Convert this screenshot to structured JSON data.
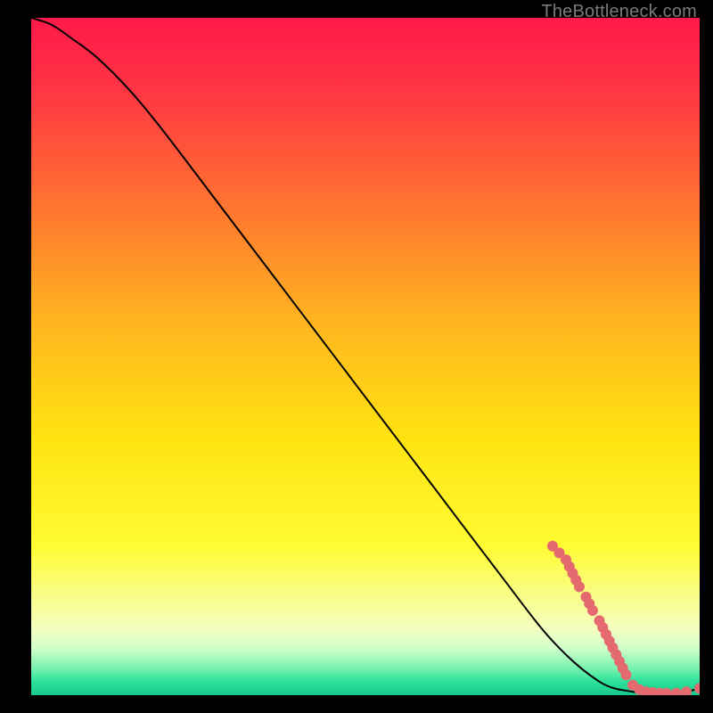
{
  "attribution": "TheBottleneck.com",
  "chart_data": {
    "type": "line",
    "title": "",
    "xlabel": "",
    "ylabel": "",
    "xlim": [
      0,
      100
    ],
    "ylim": [
      0,
      100
    ],
    "grid": false,
    "legend": false,
    "background_gradient": {
      "stops": [
        {
          "pct": 0,
          "color": "#ff1a4a"
        },
        {
          "pct": 10,
          "color": "#ff3344"
        },
        {
          "pct": 25,
          "color": "#ff6a33"
        },
        {
          "pct": 45,
          "color": "#ffb51f"
        },
        {
          "pct": 62,
          "color": "#ffe311"
        },
        {
          "pct": 78,
          "color": "#fffb33"
        },
        {
          "pct": 90,
          "color": "#f5ffbe"
        },
        {
          "pct": 93,
          "color": "#d3ffcb"
        },
        {
          "pct": 96,
          "color": "#7af2b0"
        },
        {
          "pct": 98,
          "color": "#2de29a"
        },
        {
          "pct": 100,
          "color": "#15c88f"
        }
      ]
    },
    "series": [
      {
        "name": "bottleneck-curve",
        "color": "#000000",
        "x": [
          0,
          3,
          6,
          10,
          15,
          20,
          30,
          40,
          50,
          60,
          70,
          78,
          85,
          90,
          94,
          97,
          100
        ],
        "values": [
          100,
          99,
          97,
          94,
          89,
          83,
          70,
          57,
          44,
          31,
          18,
          8,
          2,
          0.5,
          0.2,
          0.3,
          1.0
        ]
      }
    ],
    "highlight_points": {
      "name": "gpu-samples",
      "color": "#e46a6f",
      "radius": 6,
      "points": [
        {
          "x": 78,
          "y": 22
        },
        {
          "x": 79,
          "y": 21
        },
        {
          "x": 80,
          "y": 20
        },
        {
          "x": 80.5,
          "y": 19
        },
        {
          "x": 81,
          "y": 18
        },
        {
          "x": 81.5,
          "y": 17
        },
        {
          "x": 82,
          "y": 16
        },
        {
          "x": 83,
          "y": 14.5
        },
        {
          "x": 83.5,
          "y": 13.5
        },
        {
          "x": 84,
          "y": 12.5
        },
        {
          "x": 85,
          "y": 11
        },
        {
          "x": 85.5,
          "y": 10
        },
        {
          "x": 86,
          "y": 9
        },
        {
          "x": 86.5,
          "y": 8
        },
        {
          "x": 87,
          "y": 7
        },
        {
          "x": 87.5,
          "y": 6
        },
        {
          "x": 88,
          "y": 5
        },
        {
          "x": 88.5,
          "y": 4
        },
        {
          "x": 89,
          "y": 3
        },
        {
          "x": 90,
          "y": 1.5
        },
        {
          "x": 91,
          "y": 0.8
        },
        {
          "x": 92,
          "y": 0.5
        },
        {
          "x": 93,
          "y": 0.4
        },
        {
          "x": 94,
          "y": 0.3
        },
        {
          "x": 95,
          "y": 0.3
        },
        {
          "x": 96.5,
          "y": 0.3
        },
        {
          "x": 98,
          "y": 0.5
        },
        {
          "x": 100,
          "y": 1.0
        }
      ]
    }
  }
}
